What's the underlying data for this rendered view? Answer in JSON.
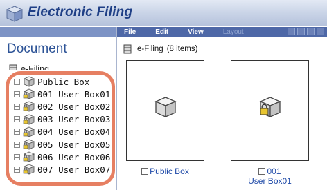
{
  "app": {
    "title": "Electronic Filing"
  },
  "left_panel": {
    "title": "Document",
    "root_label": "e-Filing",
    "tree_items": [
      {
        "label": "Public Box",
        "locked": false
      },
      {
        "label": "001 User Box01",
        "locked": true
      },
      {
        "label": "002 User Box02",
        "locked": true
      },
      {
        "label": "003 User Box03",
        "locked": true
      },
      {
        "label": "004 User Box04",
        "locked": true
      },
      {
        "label": "005 User Box05",
        "locked": true
      },
      {
        "label": "006 User Box06",
        "locked": true
      },
      {
        "label": "007 User Box07",
        "locked": true
      }
    ],
    "expander_symbol": "+"
  },
  "menubar": {
    "file": "File",
    "edit": "Edit",
    "view": "View",
    "layout": "Layout"
  },
  "content": {
    "path_label": "e-Filing",
    "item_count": "(8 items)",
    "items": [
      {
        "name": "Public Box",
        "line2": ""
      },
      {
        "name": "001",
        "line2": "User Box01"
      }
    ]
  },
  "colors": {
    "accent": "#e67f62",
    "menubar": "#4e68a7",
    "link": "#1f4aa8"
  }
}
